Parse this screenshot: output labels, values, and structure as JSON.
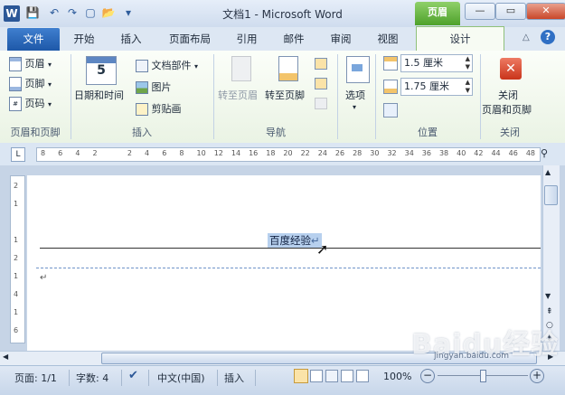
{
  "window": {
    "title": "文档1 - Microsoft Word",
    "context_tab": "页眉",
    "buttons": {
      "minimize": "—",
      "maximize": "▭",
      "close": "✕"
    }
  },
  "quick_access": {
    "app_icon": "W",
    "save": "💾",
    "undo": "↶",
    "redo": "↷",
    "new": "▢",
    "open": "📂",
    "customize": "▾"
  },
  "tabs": [
    "文件",
    "开始",
    "插入",
    "页面布局",
    "引用",
    "邮件",
    "审阅",
    "视图",
    "设计"
  ],
  "ribbon": {
    "groups": {
      "header_footer": {
        "label": "页眉和页脚",
        "items": [
          "页眉",
          "页脚",
          "页码"
        ]
      },
      "insert": {
        "label": "插入",
        "big": "日期和时间",
        "items": [
          "文档部件",
          "图片",
          "剪贴画"
        ]
      },
      "navigation": {
        "label": "导航",
        "goto_header": "转至页眉",
        "goto_footer": "转至页脚"
      },
      "options": {
        "label": "选项"
      },
      "position": {
        "label": "位置",
        "header_pos": "1.5 厘米",
        "footer_pos": "1.75 厘米"
      },
      "close": {
        "label": "关闭",
        "button": "关闭",
        "button_line2": "页眉和页脚"
      }
    },
    "collapse": "△",
    "help": "?"
  },
  "ruler": {
    "ticks": [
      "8",
      "6",
      "4",
      "2",
      "",
      "2",
      "4",
      "6",
      "8",
      "10",
      "12",
      "14",
      "16",
      "18",
      "20",
      "22",
      "24",
      "26",
      "28",
      "30",
      "32",
      "34",
      "36",
      "38",
      "40",
      "42",
      "44",
      "46",
      "48"
    ],
    "vticks": [
      "2",
      "1",
      "",
      "1",
      "2",
      "1",
      "4",
      "1",
      "6"
    ]
  },
  "document": {
    "header_text": "百度经验",
    "para_mark": "↵"
  },
  "status": {
    "page": "页面: 1/1",
    "words": "字数: 4",
    "language": "中文(中国)",
    "mode": "插入",
    "zoom": "100%"
  },
  "watermark": {
    "brand": "Baidu经验",
    "url": "jingyan.baidu.com"
  }
}
